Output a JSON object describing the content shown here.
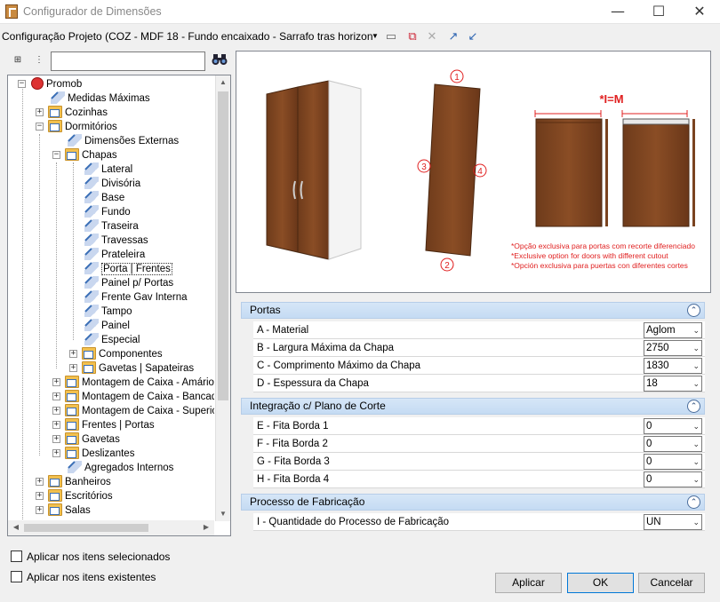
{
  "window": {
    "title": "Configurador de Dimensões",
    "min": "—",
    "max": "☐",
    "close": "✕"
  },
  "toolbar": {
    "config_value": "Configuração Projeto (COZ - MDF 18 - Fundo encaixado - Sarrafo tras horizon"
  },
  "tree": {
    "items": [
      {
        "label": "Promob"
      },
      {
        "label": "Medidas Máximas"
      },
      {
        "label": "Cozinhas"
      },
      {
        "label": "Dormitórios"
      },
      {
        "label": "Dimensões Externas"
      },
      {
        "label": "Chapas"
      },
      {
        "label": "Lateral"
      },
      {
        "label": "Divisória"
      },
      {
        "label": "Base"
      },
      {
        "label": "Fundo"
      },
      {
        "label": "Traseira"
      },
      {
        "label": "Travessas"
      },
      {
        "label": "Prateleira"
      },
      {
        "label": "Porta | Frentes"
      },
      {
        "label": "Painel p/ Portas"
      },
      {
        "label": "Frente Gav Interna"
      },
      {
        "label": "Tampo"
      },
      {
        "label": "Painel"
      },
      {
        "label": "Especial"
      },
      {
        "label": "Componentes"
      },
      {
        "label": "Gavetas | Sapateiras"
      },
      {
        "label": "Montagem de Caixa - Amários"
      },
      {
        "label": "Montagem de Caixa - Bancadas"
      },
      {
        "label": "Montagem de Caixa - Superior"
      },
      {
        "label": "Frentes | Portas"
      },
      {
        "label": "Gavetas"
      },
      {
        "label": "Deslizantes"
      },
      {
        "label": "Agregados Internos"
      },
      {
        "label": "Banheiros"
      },
      {
        "label": "Escritórios"
      },
      {
        "label": "Salas"
      }
    ]
  },
  "checkboxes": {
    "selected": "Aplicar nos itens selecionados",
    "existing": "Aplicar nos itens existentes"
  },
  "preview": {
    "formula": "*I=M",
    "markers": [
      "1",
      "2",
      "3",
      "4"
    ],
    "notes": [
      "*Opção exclusiva para portas com recorte diferenciado",
      "*Exclusive option for doors with different cutout",
      "*Opción exclusiva para puertas con diferentes cortes"
    ]
  },
  "sections": [
    {
      "title": "Portas",
      "rows": [
        {
          "label": "A - Material",
          "value": "Aglom"
        },
        {
          "label": "B - Largura Máxima da Chapa",
          "value": "2750"
        },
        {
          "label": "C - Comprimento Máximo da Chapa",
          "value": "1830"
        },
        {
          "label": "D - Espessura da Chapa",
          "value": "18"
        }
      ]
    },
    {
      "title": "Integração c/ Plano de Corte",
      "rows": [
        {
          "label": "E - Fita Borda 1",
          "value": "0"
        },
        {
          "label": "F - Fita Borda 2",
          "value": "0"
        },
        {
          "label": "G - Fita Borda 3",
          "value": "0"
        },
        {
          "label": "H - Fita Borda 4",
          "value": "0"
        }
      ]
    },
    {
      "title": "Processo de Fabricação",
      "rows": [
        {
          "label": "I - Quantidade do Processo de Fabricação",
          "value": "UN"
        }
      ]
    }
  ],
  "buttons": {
    "apply": "Aplicar",
    "ok": "OK",
    "cancel": "Cancelar"
  },
  "colors": {
    "wood": "#7a4320",
    "accent_red": "#e02020",
    "section_header": "#c9ddf4"
  }
}
